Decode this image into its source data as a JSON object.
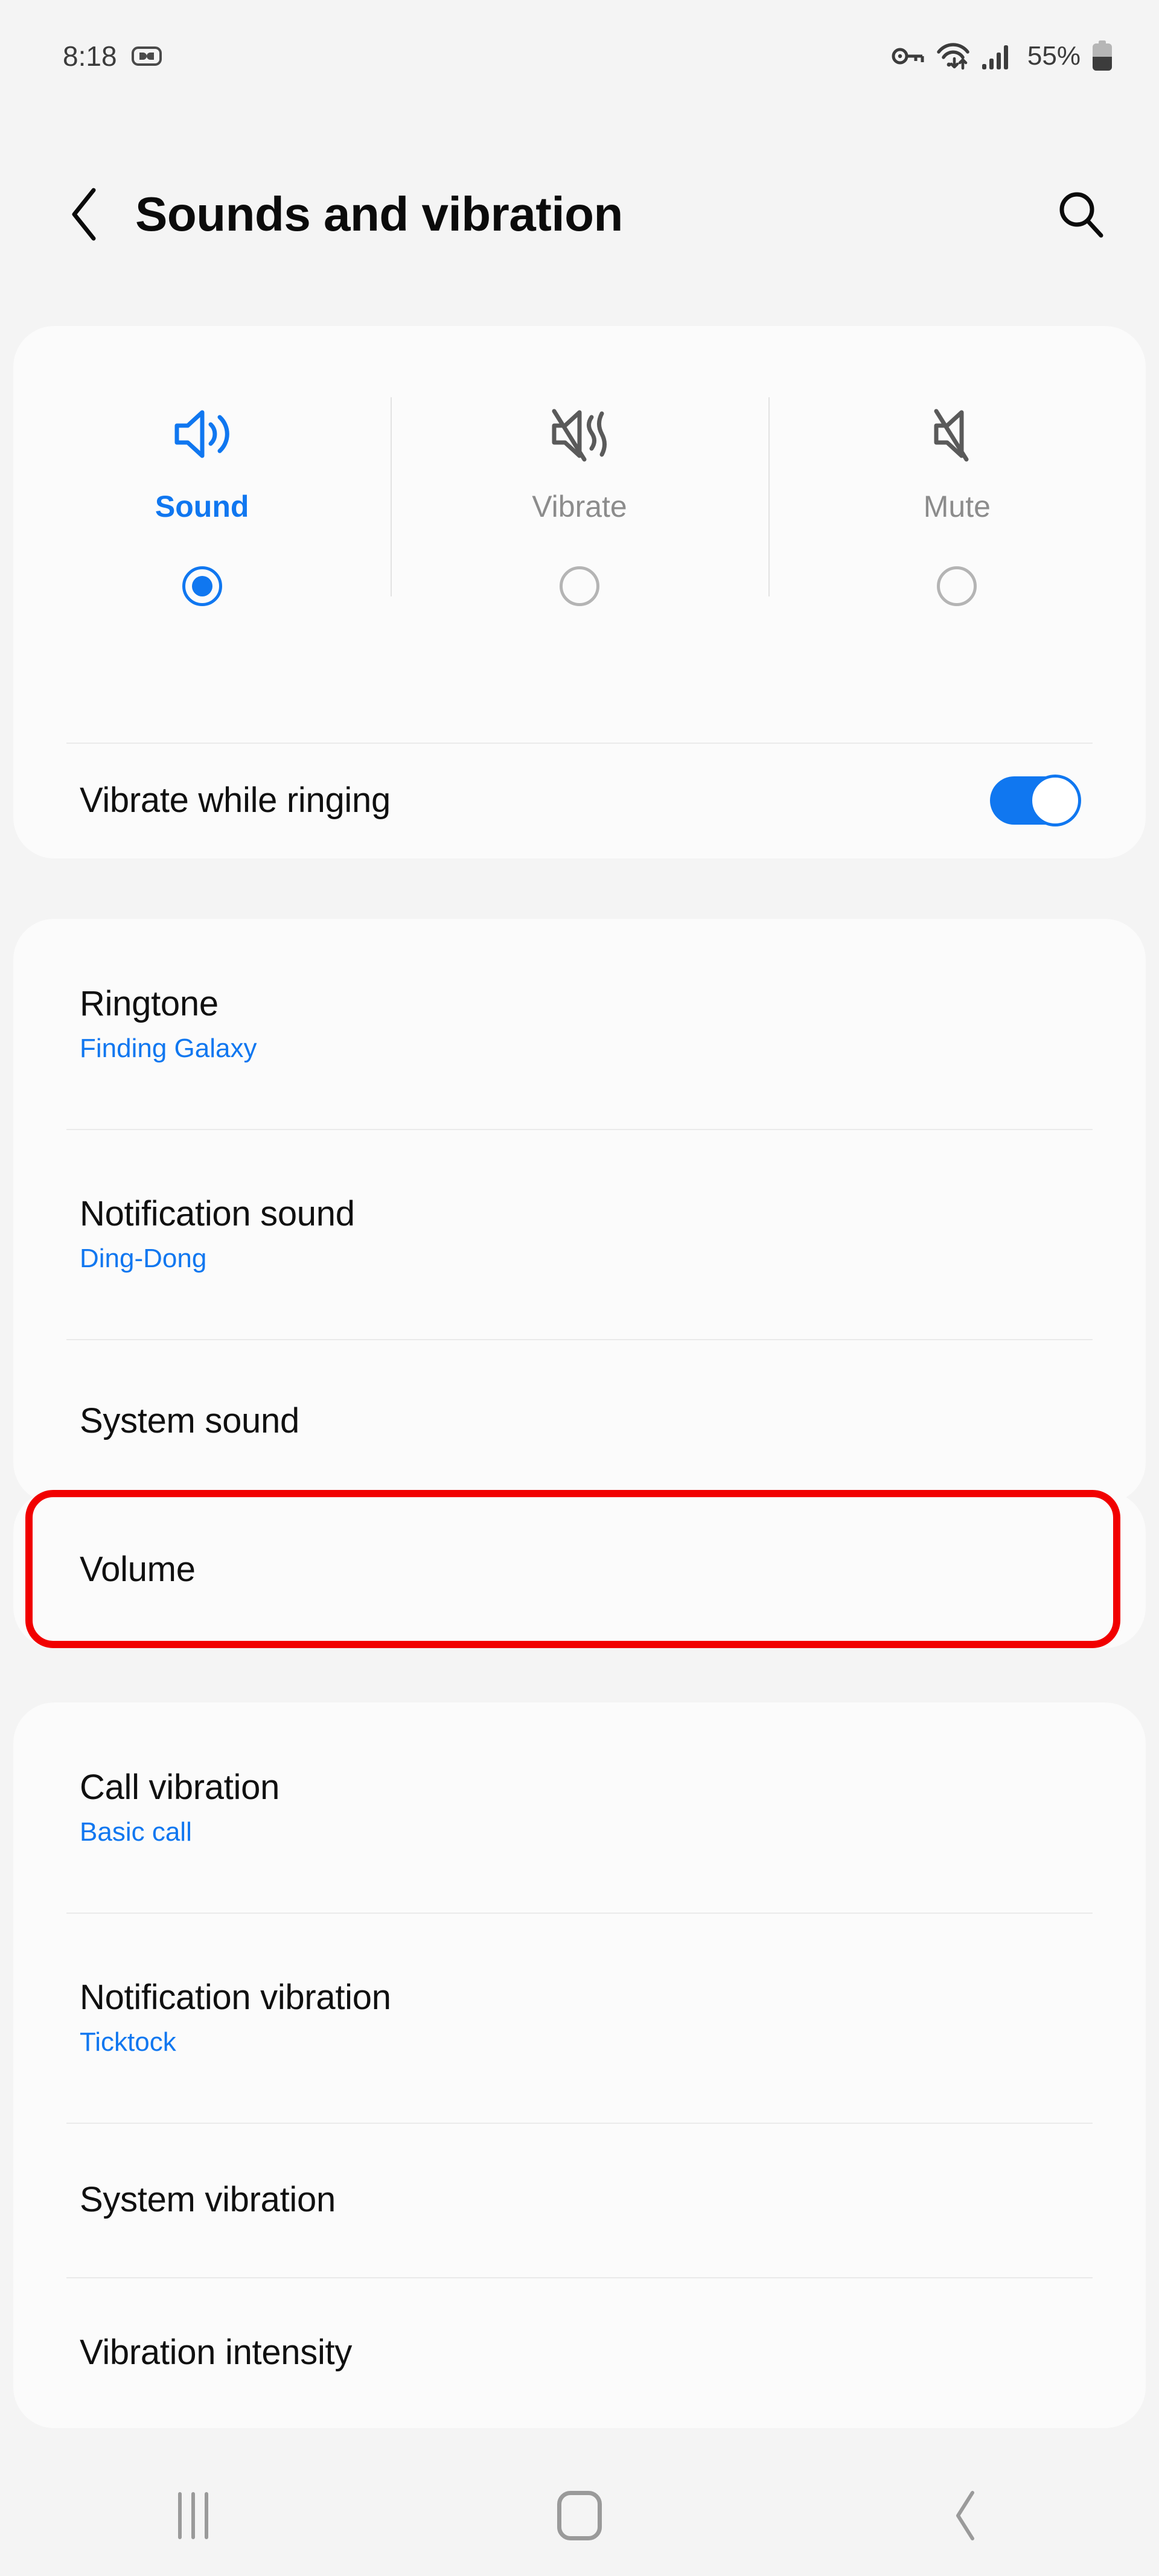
{
  "status_bar": {
    "time": "8:18",
    "battery_percent": "55%",
    "icons": [
      "dual-sim-icon",
      "vpn-key-icon",
      "wifi-icon",
      "signal-bars-icon",
      "battery-icon"
    ]
  },
  "header": {
    "back_icon": "chevron-left-icon",
    "title": "Sounds and vibration",
    "search_icon": "search-icon"
  },
  "sound_mode": {
    "options": [
      {
        "label": "Sound",
        "icon": "volume-up-icon",
        "selected": true
      },
      {
        "label": "Vibrate",
        "icon": "vibrate-icon",
        "selected": false
      },
      {
        "label": "Mute",
        "icon": "volume-mute-icon",
        "selected": false
      }
    ],
    "vibrate_while_ringing": {
      "title": "Vibrate while ringing",
      "toggle_on": true
    }
  },
  "sound_settings": [
    {
      "title": "Ringtone",
      "value": "Finding Galaxy"
    },
    {
      "title": "Notification sound",
      "value": "Ding-Dong"
    },
    {
      "title": "System sound",
      "value": ""
    }
  ],
  "volume_section": {
    "title": "Volume",
    "highlighted": true
  },
  "vibration_settings": [
    {
      "title": "Call vibration",
      "value": "Basic call"
    },
    {
      "title": "Notification vibration",
      "value": "Ticktock"
    },
    {
      "title": "System vibration",
      "value": ""
    },
    {
      "title": "Vibration intensity",
      "value": ""
    }
  ],
  "nav_bar": {
    "recents_icon": "recents-icon",
    "home_icon": "home-icon",
    "back_icon": "chevron-left-icon"
  },
  "colors": {
    "accent_blue": "#1077f0",
    "highlight_red": "#f10000",
    "background": "#f4f4f4",
    "card": "#fbfbfb",
    "text_primary": "#101010",
    "text_muted": "#8c8c8c"
  }
}
